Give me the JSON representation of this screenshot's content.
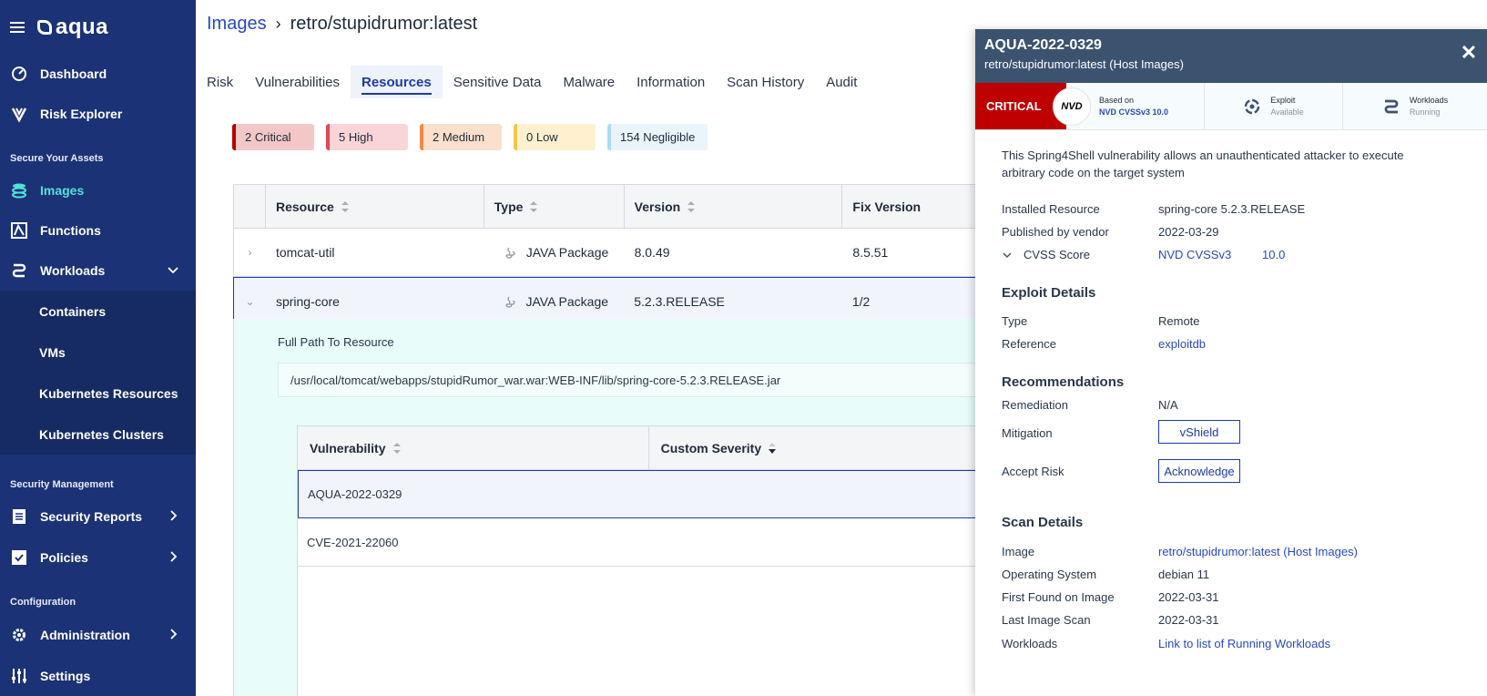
{
  "sidebar": {
    "brand": "aqua",
    "items": {
      "dashboard": "Dashboard",
      "risk_explorer": "Risk Explorer",
      "section_secure": "Secure Your Assets",
      "images": "Images",
      "functions": "Functions",
      "workloads": "Workloads",
      "containers": "Containers",
      "vms": "VMs",
      "k8s_resources": "Kubernetes Resources",
      "k8s_clusters": "Kubernetes Clusters",
      "section_security": "Security Management",
      "security_reports": "Security Reports",
      "policies": "Policies",
      "section_config": "Configuration",
      "administration": "Administration",
      "settings": "Settings"
    }
  },
  "breadcrumb": {
    "root": "Images",
    "current": "retro/stupidrumor:latest"
  },
  "tabs": [
    "Risk",
    "Vulnerabilities",
    "Resources",
    "Sensitive Data",
    "Malware",
    "Information",
    "Scan History",
    "Audit"
  ],
  "severity_counts": {
    "critical": "2 Critical",
    "high": "5 High",
    "medium": "2 Medium",
    "low": "0 Low",
    "negligible": "154 Negligible"
  },
  "resources_table": {
    "headers": [
      "Resource",
      "Type",
      "Version",
      "Fix Version"
    ],
    "rows": [
      [
        "tomcat-util",
        "JAVA Package",
        "8.0.49",
        "8.5.51"
      ],
      [
        "spring-core",
        "JAVA Package",
        "5.2.3.RELEASE",
        "1/2"
      ]
    ]
  },
  "expanded": {
    "path_label": "Full Path To Resource",
    "path_value": "/usr/local/tomcat/webapps/stupidRumor_war.war:WEB-INF/lib/spring-core-5.2.3.RELEASE.jar",
    "vuln_headers": [
      "Vulnerability",
      "Custom Severity"
    ],
    "vuln_rows": [
      "AQUA-2022-0329",
      "CVE-2021-22060"
    ]
  },
  "drawer": {
    "title": "AQUA-2022-0329",
    "subtitle": "retro/stupidrumor:latest (Host Images)",
    "severity": "CRITICAL",
    "nvd_badge": "NVD",
    "based_on_label": "Based on",
    "based_on_value": "NVD CVSSv3 10.0",
    "exploit_label": "Exploit",
    "exploit_value": "Available",
    "workloads_label": "Workloads",
    "workloads_value": "Running",
    "description": "This Spring4Shell vulnerability allows an unauthenticated attacker to execute arbitrary code on the target system",
    "installed_resource_label": "Installed Resource",
    "installed_resource": "spring-core 5.2.3.RELEASE",
    "published_label": "Published by vendor",
    "published": "2022-03-29",
    "cvss_label": "CVSS Score",
    "cvss_source": "NVD CVSSv3",
    "cvss_value": "10.0",
    "exploit_details_title": "Exploit Details",
    "type_label": "Type",
    "type_value": "Remote",
    "reference_label": "Reference",
    "reference_value": "exploitdb",
    "recommendations_title": "Recommendations",
    "remediation_label": "Remediation",
    "remediation_value": "N/A",
    "mitigation_label": "Mitigation",
    "mitigation_button": "vShield",
    "accept_risk_label": "Accept Risk",
    "accept_risk_button": "Acknowledge",
    "scan_details_title": "Scan Details",
    "image_label": "Image",
    "image_value": "retro/stupidrumor:latest (Host Images)",
    "os_label": "Operating System",
    "os_value": "debian 11",
    "first_found_label": "First Found on Image",
    "first_found_value": "2022-03-31",
    "last_scan_label": "Last Image Scan",
    "last_scan_value": "2022-03-31",
    "workloads_row_label": "Workloads",
    "workloads_link": "Link to list of Running Workloads"
  },
  "colors": {
    "sidebar_bg": "#1c3276",
    "active_nav": "#4fe3d8",
    "critical": "#bf0000",
    "link": "#2849bf"
  }
}
